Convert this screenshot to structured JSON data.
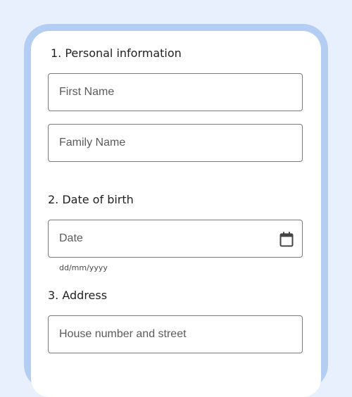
{
  "form": {
    "section1_heading": "1. Personal information",
    "first_name": {
      "placeholder": "First Name",
      "value": ""
    },
    "family_name": {
      "placeholder": "Family Name",
      "value": ""
    },
    "section2_heading": "2. Date of birth",
    "date": {
      "placeholder": "Date",
      "value": "",
      "helper": "dd/mm/yyyy"
    },
    "calendar_icon": "calendar-icon",
    "section3_heading": "3. Address",
    "address": {
      "placeholder": "House number and street",
      "value": ""
    }
  },
  "colors": {
    "page_background": "#e8effd",
    "device_frame": "#b3cdf3",
    "field_border": "#7a7a7a"
  }
}
